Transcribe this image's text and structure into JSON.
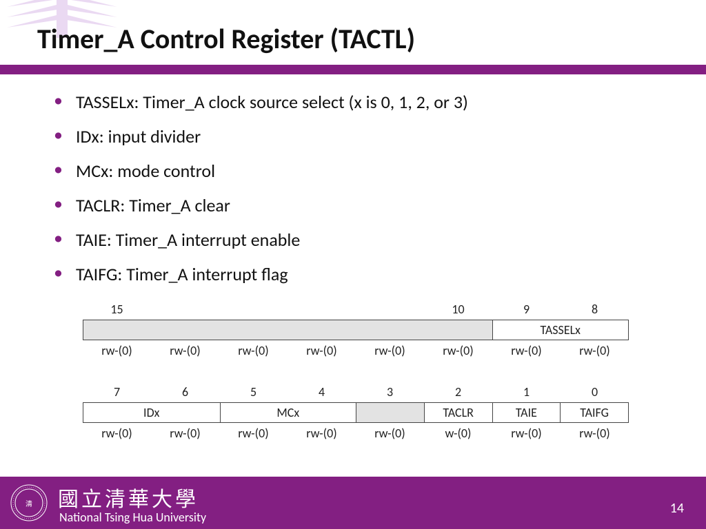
{
  "title": "Timer_A Control Register (TACTL)",
  "bullets": [
    "TASSELx: Timer_A clock source select (x is 0, 1, 2, or 3)",
    "IDx: input divider",
    "MCx: mode control",
    "TACLR: Timer_A clear",
    "TAIE: Timer_A interrupt enable",
    "TAIFG: Timer_A interrupt flag"
  ],
  "reg_top": {
    "bitnums": [
      "15",
      "",
      "",
      "",
      "",
      "10",
      "9",
      "8"
    ],
    "fields": [
      {
        "label": "",
        "span": 6,
        "grey": true
      },
      {
        "label": "TASSELx",
        "span": 2,
        "grey": false
      }
    ],
    "rw": [
      "rw-(0)",
      "rw-(0)",
      "rw-(0)",
      "rw-(0)",
      "rw-(0)",
      "rw-(0)",
      "rw-(0)",
      "rw-(0)"
    ]
  },
  "reg_bot": {
    "bitnums": [
      "7",
      "6",
      "5",
      "4",
      "3",
      "2",
      "1",
      "0"
    ],
    "fields": [
      {
        "label": "IDx",
        "span": 2,
        "grey": false
      },
      {
        "label": "MCx",
        "span": 2,
        "grey": false
      },
      {
        "label": "",
        "span": 1,
        "grey": true
      },
      {
        "label": "TACLR",
        "span": 1,
        "grey": false
      },
      {
        "label": "TAIE",
        "span": 1,
        "grey": false
      },
      {
        "label": "TAIFG",
        "span": 1,
        "grey": false
      }
    ],
    "rw": [
      "rw-(0)",
      "rw-(0)",
      "rw-(0)",
      "rw-(0)",
      "rw-(0)",
      "w-(0)",
      "rw-(0)",
      "rw-(0)"
    ]
  },
  "footer": {
    "uni_zh": "國立清華大學",
    "uni_en": "National Tsing Hua University",
    "page": "14"
  }
}
